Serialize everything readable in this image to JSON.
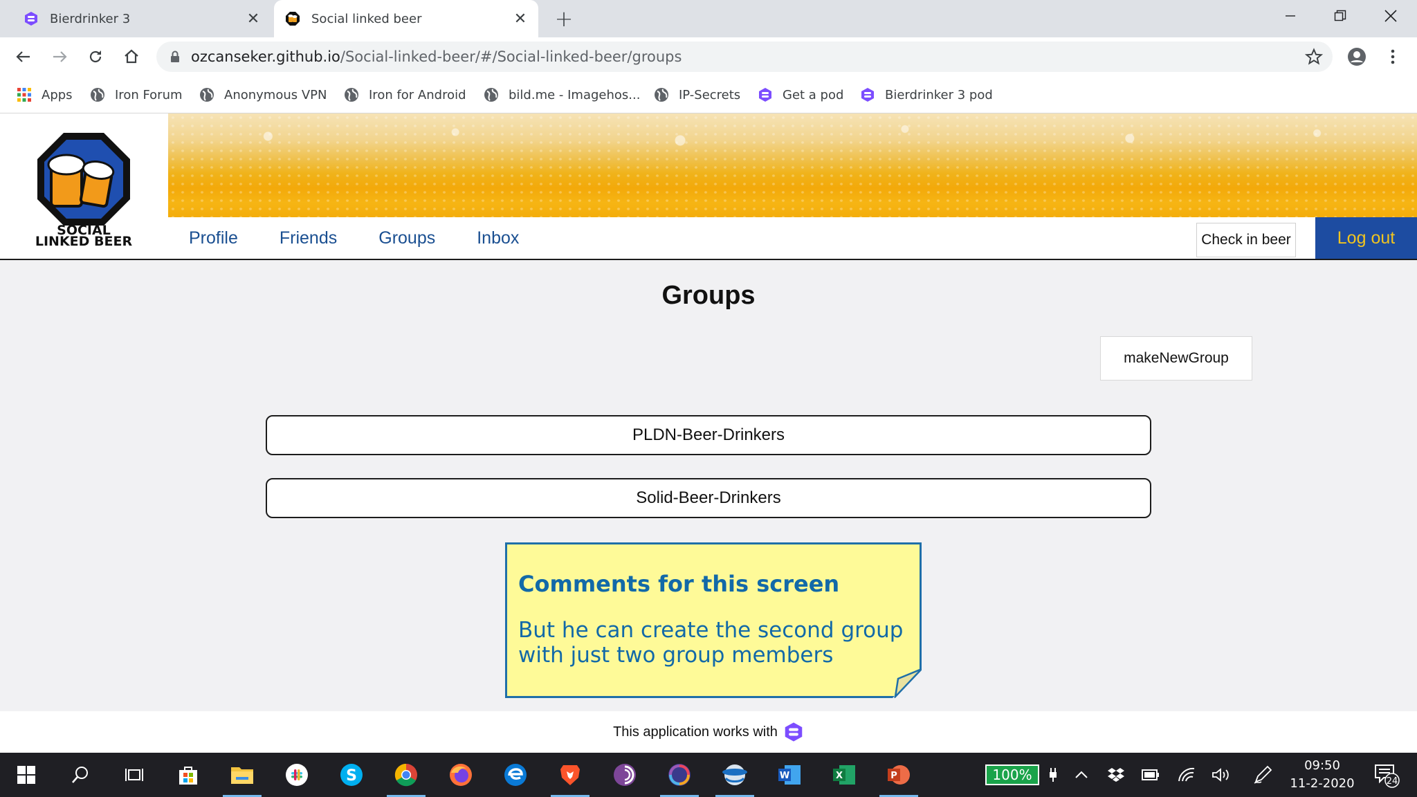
{
  "browser": {
    "tabs": [
      {
        "title": "Bierdrinker 3",
        "active": false
      },
      {
        "title": "Social linked beer",
        "active": true
      }
    ],
    "address": {
      "host": "ozcanseker.github.io",
      "path": "/Social-linked-beer/#/Social-linked-beer/groups"
    },
    "bookmarks": [
      {
        "label": "Apps",
        "icon": "apps-grid-icon"
      },
      {
        "label": "Iron Forum",
        "icon": "globe-icon"
      },
      {
        "label": "Anonymous VPN",
        "icon": "globe-icon"
      },
      {
        "label": "Iron for Android",
        "icon": "globe-icon"
      },
      {
        "label": "bild.me - Imagehos...",
        "icon": "globe-icon"
      },
      {
        "label": "IP-Secrets",
        "icon": "globe-icon"
      },
      {
        "label": "Get a pod",
        "icon": "solid-icon"
      },
      {
        "label": "Bierdrinker 3 pod",
        "icon": "solid-icon"
      }
    ]
  },
  "site": {
    "logo_text": [
      "SOCIAL",
      "LINKED BEER"
    ],
    "nav": [
      "Profile",
      "Friends",
      "Groups",
      "Inbox"
    ],
    "checkin_label": "Check in beer",
    "logout_label": "Log out"
  },
  "main": {
    "title": "Groups",
    "new_group_label": "makeNewGroup",
    "groups": [
      "PLDN-Beer-Drinkers",
      "Solid-Beer-Drinkers"
    ]
  },
  "note": {
    "title": "Comments for this screen",
    "body_line1": "But he can create the second group",
    "body_line2": "with just two group members"
  },
  "footer": {
    "text": "This application works with"
  },
  "taskbar": {
    "battery": "100%",
    "time": "09:50",
    "date": "11-2-2020",
    "notifications": "24"
  },
  "colors": {
    "nav_link": "#1a4f91",
    "logout_bg": "#1d4ca1",
    "logout_text": "#f0c420",
    "note_bg": "#fefa98",
    "note_text": "#1269a8",
    "solid_purple": "#7c4dff"
  }
}
